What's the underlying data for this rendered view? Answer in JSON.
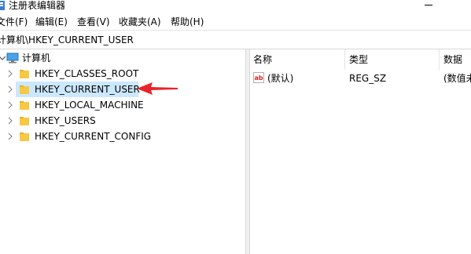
{
  "window": {
    "title": "注册表编辑器",
    "icon": "regedit-icon"
  },
  "menu": {
    "items": [
      "文件(F)",
      "编辑(E)",
      "查看(V)",
      "收藏夹(A)",
      "帮助(H)"
    ]
  },
  "address": {
    "path": "计算机\\HKEY_CURRENT_USER"
  },
  "tree": {
    "root": "计算机",
    "items": [
      {
        "label": "HKEY_CLASSES_ROOT",
        "selected": false
      },
      {
        "label": "HKEY_CURRENT_USER",
        "selected": true
      },
      {
        "label": "HKEY_LOCAL_MACHINE",
        "selected": false
      },
      {
        "label": "HKEY_USERS",
        "selected": false
      },
      {
        "label": "HKEY_CURRENT_CONFIG",
        "selected": false
      }
    ]
  },
  "list": {
    "columns": [
      "名称",
      "类型",
      "数据"
    ],
    "rows": [
      {
        "name": "(默认)",
        "type": "REG_SZ",
        "data": "(数值未"
      }
    ]
  },
  "colors": {
    "selection": "#cce8ff",
    "folder": "#f7c843",
    "annotation_arrow": "#e8242a"
  }
}
